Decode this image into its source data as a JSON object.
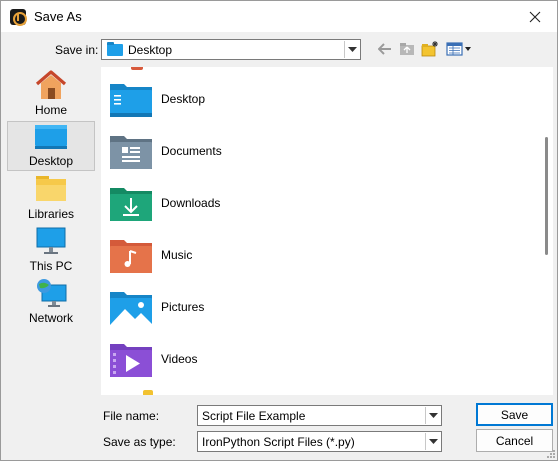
{
  "window": {
    "title": "Save As"
  },
  "savein": {
    "label": "Save in:",
    "value": "Desktop"
  },
  "places": [
    {
      "label": "Home",
      "icon": "home-icon"
    },
    {
      "label": "Desktop",
      "icon": "desktop-icon"
    },
    {
      "label": "Libraries",
      "icon": "libraries-icon"
    },
    {
      "label": "This PC",
      "icon": "this-pc-icon"
    },
    {
      "label": "Network",
      "icon": "network-icon"
    }
  ],
  "files": [
    {
      "name": "Desktop",
      "icon": "desktop-folder-icon"
    },
    {
      "name": "Documents",
      "icon": "documents-folder-icon"
    },
    {
      "name": "Downloads",
      "icon": "downloads-folder-icon"
    },
    {
      "name": "Music",
      "icon": "music-folder-icon"
    },
    {
      "name": "Pictures",
      "icon": "pictures-folder-icon"
    },
    {
      "name": "Videos",
      "icon": "videos-folder-icon"
    }
  ],
  "filename": {
    "label": "File name:",
    "value": "Script File Example"
  },
  "filetype": {
    "label": "Save as type:",
    "value": "IronPython Script Files (*.py)"
  },
  "buttons": {
    "save": "Save",
    "cancel": "Cancel"
  },
  "colors": {
    "accent": "#0078d4",
    "folder_blue": "#1e9fe8",
    "folder_green": "#1ea67a",
    "folder_orange": "#e5734a",
    "folder_purple": "#8b4fd6"
  }
}
